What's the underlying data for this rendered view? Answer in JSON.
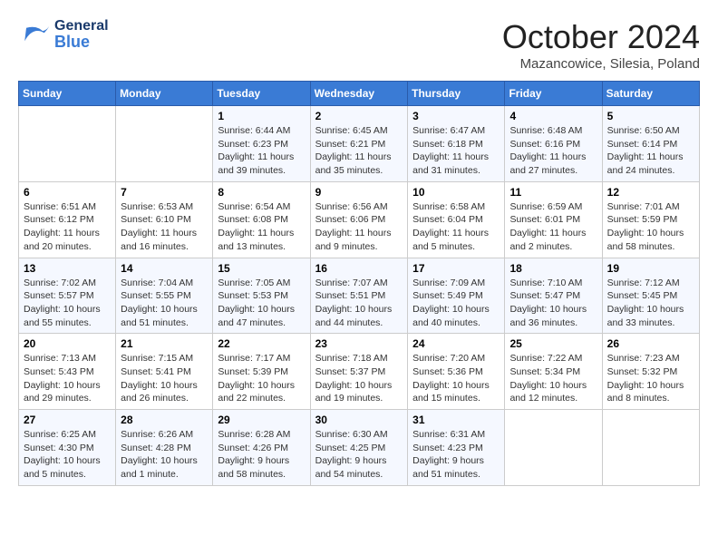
{
  "header": {
    "logo_general": "General",
    "logo_blue": "Blue",
    "month_title": "October 2024",
    "location": "Mazancowice, Silesia, Poland"
  },
  "days_of_week": [
    "Sunday",
    "Monday",
    "Tuesday",
    "Wednesday",
    "Thursday",
    "Friday",
    "Saturday"
  ],
  "weeks": [
    [
      {
        "day": "",
        "sunrise": "",
        "sunset": "",
        "daylight": ""
      },
      {
        "day": "",
        "sunrise": "",
        "sunset": "",
        "daylight": ""
      },
      {
        "day": "1",
        "sunrise": "Sunrise: 6:44 AM",
        "sunset": "Sunset: 6:23 PM",
        "daylight": "Daylight: 11 hours and 39 minutes."
      },
      {
        "day": "2",
        "sunrise": "Sunrise: 6:45 AM",
        "sunset": "Sunset: 6:21 PM",
        "daylight": "Daylight: 11 hours and 35 minutes."
      },
      {
        "day": "3",
        "sunrise": "Sunrise: 6:47 AM",
        "sunset": "Sunset: 6:18 PM",
        "daylight": "Daylight: 11 hours and 31 minutes."
      },
      {
        "day": "4",
        "sunrise": "Sunrise: 6:48 AM",
        "sunset": "Sunset: 6:16 PM",
        "daylight": "Daylight: 11 hours and 27 minutes."
      },
      {
        "day": "5",
        "sunrise": "Sunrise: 6:50 AM",
        "sunset": "Sunset: 6:14 PM",
        "daylight": "Daylight: 11 hours and 24 minutes."
      }
    ],
    [
      {
        "day": "6",
        "sunrise": "Sunrise: 6:51 AM",
        "sunset": "Sunset: 6:12 PM",
        "daylight": "Daylight: 11 hours and 20 minutes."
      },
      {
        "day": "7",
        "sunrise": "Sunrise: 6:53 AM",
        "sunset": "Sunset: 6:10 PM",
        "daylight": "Daylight: 11 hours and 16 minutes."
      },
      {
        "day": "8",
        "sunrise": "Sunrise: 6:54 AM",
        "sunset": "Sunset: 6:08 PM",
        "daylight": "Daylight: 11 hours and 13 minutes."
      },
      {
        "day": "9",
        "sunrise": "Sunrise: 6:56 AM",
        "sunset": "Sunset: 6:06 PM",
        "daylight": "Daylight: 11 hours and 9 minutes."
      },
      {
        "day": "10",
        "sunrise": "Sunrise: 6:58 AM",
        "sunset": "Sunset: 6:04 PM",
        "daylight": "Daylight: 11 hours and 5 minutes."
      },
      {
        "day": "11",
        "sunrise": "Sunrise: 6:59 AM",
        "sunset": "Sunset: 6:01 PM",
        "daylight": "Daylight: 11 hours and 2 minutes."
      },
      {
        "day": "12",
        "sunrise": "Sunrise: 7:01 AM",
        "sunset": "Sunset: 5:59 PM",
        "daylight": "Daylight: 10 hours and 58 minutes."
      }
    ],
    [
      {
        "day": "13",
        "sunrise": "Sunrise: 7:02 AM",
        "sunset": "Sunset: 5:57 PM",
        "daylight": "Daylight: 10 hours and 55 minutes."
      },
      {
        "day": "14",
        "sunrise": "Sunrise: 7:04 AM",
        "sunset": "Sunset: 5:55 PM",
        "daylight": "Daylight: 10 hours and 51 minutes."
      },
      {
        "day": "15",
        "sunrise": "Sunrise: 7:05 AM",
        "sunset": "Sunset: 5:53 PM",
        "daylight": "Daylight: 10 hours and 47 minutes."
      },
      {
        "day": "16",
        "sunrise": "Sunrise: 7:07 AM",
        "sunset": "Sunset: 5:51 PM",
        "daylight": "Daylight: 10 hours and 44 minutes."
      },
      {
        "day": "17",
        "sunrise": "Sunrise: 7:09 AM",
        "sunset": "Sunset: 5:49 PM",
        "daylight": "Daylight: 10 hours and 40 minutes."
      },
      {
        "day": "18",
        "sunrise": "Sunrise: 7:10 AM",
        "sunset": "Sunset: 5:47 PM",
        "daylight": "Daylight: 10 hours and 36 minutes."
      },
      {
        "day": "19",
        "sunrise": "Sunrise: 7:12 AM",
        "sunset": "Sunset: 5:45 PM",
        "daylight": "Daylight: 10 hours and 33 minutes."
      }
    ],
    [
      {
        "day": "20",
        "sunrise": "Sunrise: 7:13 AM",
        "sunset": "Sunset: 5:43 PM",
        "daylight": "Daylight: 10 hours and 29 minutes."
      },
      {
        "day": "21",
        "sunrise": "Sunrise: 7:15 AM",
        "sunset": "Sunset: 5:41 PM",
        "daylight": "Daylight: 10 hours and 26 minutes."
      },
      {
        "day": "22",
        "sunrise": "Sunrise: 7:17 AM",
        "sunset": "Sunset: 5:39 PM",
        "daylight": "Daylight: 10 hours and 22 minutes."
      },
      {
        "day": "23",
        "sunrise": "Sunrise: 7:18 AM",
        "sunset": "Sunset: 5:37 PM",
        "daylight": "Daylight: 10 hours and 19 minutes."
      },
      {
        "day": "24",
        "sunrise": "Sunrise: 7:20 AM",
        "sunset": "Sunset: 5:36 PM",
        "daylight": "Daylight: 10 hours and 15 minutes."
      },
      {
        "day": "25",
        "sunrise": "Sunrise: 7:22 AM",
        "sunset": "Sunset: 5:34 PM",
        "daylight": "Daylight: 10 hours and 12 minutes."
      },
      {
        "day": "26",
        "sunrise": "Sunrise: 7:23 AM",
        "sunset": "Sunset: 5:32 PM",
        "daylight": "Daylight: 10 hours and 8 minutes."
      }
    ],
    [
      {
        "day": "27",
        "sunrise": "Sunrise: 6:25 AM",
        "sunset": "Sunset: 4:30 PM",
        "daylight": "Daylight: 10 hours and 5 minutes."
      },
      {
        "day": "28",
        "sunrise": "Sunrise: 6:26 AM",
        "sunset": "Sunset: 4:28 PM",
        "daylight": "Daylight: 10 hours and 1 minute."
      },
      {
        "day": "29",
        "sunrise": "Sunrise: 6:28 AM",
        "sunset": "Sunset: 4:26 PM",
        "daylight": "Daylight: 9 hours and 58 minutes."
      },
      {
        "day": "30",
        "sunrise": "Sunrise: 6:30 AM",
        "sunset": "Sunset: 4:25 PM",
        "daylight": "Daylight: 9 hours and 54 minutes."
      },
      {
        "day": "31",
        "sunrise": "Sunrise: 6:31 AM",
        "sunset": "Sunset: 4:23 PM",
        "daylight": "Daylight: 9 hours and 51 minutes."
      },
      {
        "day": "",
        "sunrise": "",
        "sunset": "",
        "daylight": ""
      },
      {
        "day": "",
        "sunrise": "",
        "sunset": "",
        "daylight": ""
      }
    ]
  ]
}
